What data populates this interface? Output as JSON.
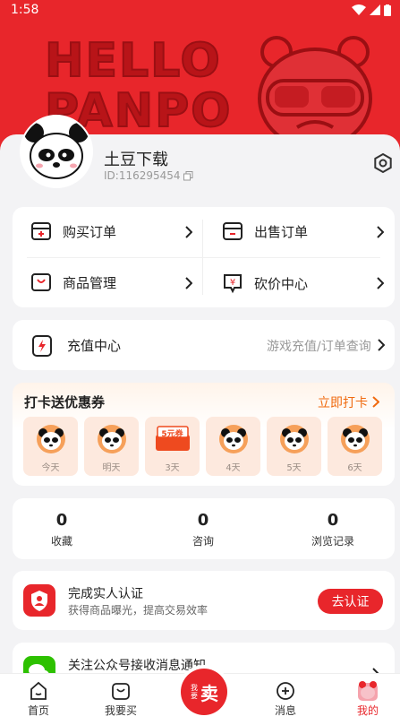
{
  "status": {
    "time": "1:58"
  },
  "hero": {
    "line1": "HELLO",
    "line2": "PANPO"
  },
  "profile": {
    "name": "土豆下载",
    "id_text": "ID:116295454"
  },
  "orders": {
    "buy": "购买订单",
    "sell": "出售订单",
    "goods": "商品管理",
    "bargain": "砍价中心"
  },
  "recharge": {
    "title": "充值中心",
    "subtitle": "游戏充值/订单查询"
  },
  "checkin": {
    "title": "打卡送优惠券",
    "action": "立即打卡",
    "coupon_text": "5元券",
    "days": [
      "今天",
      "明天",
      "3天",
      "4天",
      "5天",
      "6天"
    ]
  },
  "stats": [
    {
      "value": "0",
      "label": "收藏"
    },
    {
      "value": "0",
      "label": "咨询"
    },
    {
      "value": "0",
      "label": "浏览记录"
    }
  ],
  "verify": {
    "title": "完成实人认证",
    "subtitle": "获得商品曝光，提高交易效率",
    "button": "去认证"
  },
  "notice": {
    "title": "关注公众号接收消息通知"
  },
  "tabs": {
    "home": "首页",
    "want": "我要买",
    "sell_top": "我要",
    "sell": "卖",
    "messages": "消息",
    "mine": "我的"
  },
  "colors": {
    "accent": "#e8262b",
    "orange": "#f06a0f"
  }
}
